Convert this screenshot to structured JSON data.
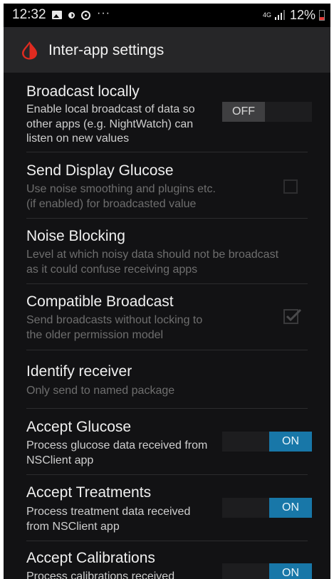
{
  "status_bar": {
    "time": "12:32",
    "more": "···",
    "network": "4G",
    "battery": "12%",
    "icons": [
      "gallery-icon",
      "drop-icon",
      "sync-icon",
      "overflow-icon",
      "signal-icon",
      "battery-icon"
    ]
  },
  "app_bar": {
    "title": "Inter-app settings",
    "logo_icon": "blood-drop-icon",
    "logo_color": "#e02b20"
  },
  "settings": {
    "broadcast_locally": {
      "title": "Broadcast locally",
      "summary": "Enable local broadcast of data so other apps (e.g. NightWatch) can listen on new values",
      "toggle_label": "OFF",
      "enabled": true
    },
    "send_display_glucose": {
      "title": "Send Display Glucose",
      "summary": "Use noise smoothing and plugins etc. (if enabled) for broadcasted value",
      "checked": false,
      "enabled": false
    },
    "noise_blocking": {
      "title": "Noise Blocking",
      "summary": "Level at which noisy data should not be broadcast as it could confuse receiving apps",
      "enabled": false
    },
    "compatible_broadcast": {
      "title": "Compatible Broadcast",
      "summary": "Send broadcasts without locking to the older permission model",
      "checked": true,
      "enabled": false
    },
    "identify_receiver": {
      "title": "Identify receiver",
      "summary": "Only send to named package",
      "enabled": false
    },
    "accept_glucose": {
      "title": "Accept Glucose",
      "summary": "Process glucose data received from NSClient app",
      "toggle_label": "ON",
      "enabled": true
    },
    "accept_treatments": {
      "title": "Accept Treatments",
      "summary": "Process treatment data received from NSClient app",
      "toggle_label": "ON",
      "enabled": true
    },
    "accept_calibrations": {
      "title": "Accept Calibrations",
      "summary": "Process calibrations received",
      "toggle_label": "ON",
      "enabled": true
    }
  },
  "colors": {
    "accent_on": "#1877a8",
    "background": "#121214",
    "app_bar": "#262628",
    "disabled_text": "#6e6e6e"
  }
}
